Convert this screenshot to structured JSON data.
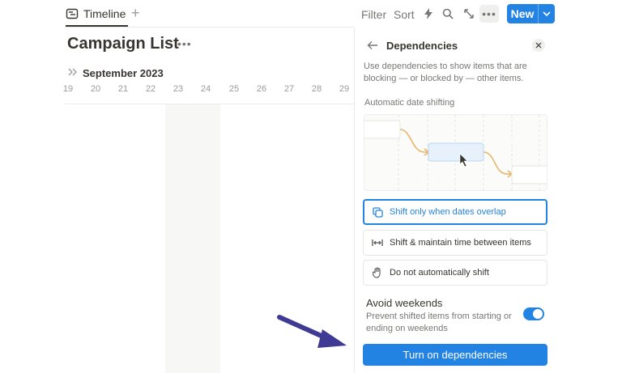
{
  "topbar": {
    "view_tab_label": "Timeline",
    "add_view_label": "+",
    "filter_label": "Filter",
    "sort_label": "Sort",
    "automation_icon": "lightning-icon",
    "search_icon": "search-icon",
    "expand_icon": "expand-diagonal-icon",
    "more_label": "•••",
    "new_label": "New",
    "new_chevron_icon": "chevron-down-icon"
  },
  "page": {
    "title": "Campaign List",
    "title_more": "•••",
    "month_label": "September 2023",
    "days": [
      "19",
      "20",
      "21",
      "22",
      "23",
      "24",
      "25",
      "26",
      "27",
      "28",
      "29"
    ]
  },
  "panel": {
    "title": "Dependencies",
    "description": "Use dependencies to show items that are blocking — or blocked by — other items.",
    "section_label": "Automatic date shifting",
    "options": [
      {
        "label": "Shift only when dates overlap",
        "icon": "overlap-icon",
        "selected": true
      },
      {
        "label": "Shift & maintain time between items",
        "icon": "maintain-gap-icon",
        "selected": false
      },
      {
        "label": "Do not automatically shift",
        "icon": "hand-icon",
        "selected": false
      }
    ],
    "avoid_weekends_title": "Avoid weekends",
    "avoid_weekends_desc": "Prevent shifted items from starting or ending on weekends",
    "avoid_weekends_on": true,
    "primary_button_label": "Turn on dependencies"
  },
  "colors": {
    "accent": "#2383e2",
    "annotation_arrow": "#3f3a94",
    "connector": "#e8b566"
  }
}
